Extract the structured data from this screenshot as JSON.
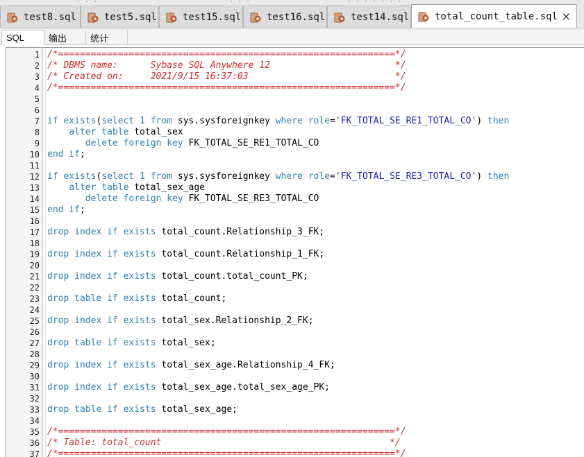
{
  "tabs": [
    {
      "label": "test8.sql",
      "active": false
    },
    {
      "label": "test5.sql",
      "active": false
    },
    {
      "label": "test15.sql",
      "active": false
    },
    {
      "label": "test16.sql",
      "active": false
    },
    {
      "label": "test14.sql",
      "active": false
    },
    {
      "label": "total_count_table.sql",
      "active": true
    }
  ],
  "close_icon": "×",
  "subtabs": [
    "SQL",
    "输出",
    "统计"
  ],
  "colors": {
    "keyword": "#2f7fb5",
    "string": "#1d1da8",
    "comment": "#d22b2b",
    "icon": "#c47a4f"
  },
  "code_lines": [
    {
      "n": "1",
      "t": [
        [
          "cm",
          "/*==============================================================*/"
        ]
      ]
    },
    {
      "n": "2",
      "t": [
        [
          "cm",
          "/* DBMS name:      Sybase SQL Anywhere 12                       */"
        ]
      ]
    },
    {
      "n": "3",
      "t": [
        [
          "cm",
          "/* Created on:     2021/9/15 16:37:03                           */"
        ]
      ]
    },
    {
      "n": "4",
      "t": [
        [
          "cm",
          "/*==============================================================*/"
        ]
      ]
    },
    {
      "n": "5",
      "t": []
    },
    {
      "n": "6",
      "t": []
    },
    {
      "n": "7",
      "t": [
        [
          "kw",
          "if exists"
        ],
        [
          "",
          "("
        ],
        [
          "kw",
          "select"
        ],
        [
          "",
          " "
        ],
        [
          "num",
          "1"
        ],
        [
          "",
          " "
        ],
        [
          "kw",
          "from"
        ],
        [
          "",
          " sys.sysforeignkey "
        ],
        [
          "kw",
          "where"
        ],
        [
          "",
          " "
        ],
        [
          "kw",
          "role"
        ],
        [
          "",
          "="
        ],
        [
          "str",
          "'FK_TOTAL_SE_RE1_TOTAL_CO'"
        ],
        [
          "",
          ") "
        ],
        [
          "kw",
          "then"
        ]
      ]
    },
    {
      "n": "8",
      "t": [
        [
          "",
          "    "
        ],
        [
          "kw",
          "alter table"
        ],
        [
          "",
          " total_sex"
        ]
      ]
    },
    {
      "n": "9",
      "t": [
        [
          "",
          "       "
        ],
        [
          "kw",
          "delete foreign key"
        ],
        [
          "",
          " FK_TOTAL_SE_RE1_TOTAL_CO"
        ]
      ]
    },
    {
      "n": "10",
      "t": [
        [
          "kw",
          "end if"
        ],
        [
          "",
          ";"
        ]
      ]
    },
    {
      "n": "11",
      "t": []
    },
    {
      "n": "12",
      "t": [
        [
          "kw",
          "if exists"
        ],
        [
          "",
          "("
        ],
        [
          "kw",
          "select"
        ],
        [
          "",
          " "
        ],
        [
          "num",
          "1"
        ],
        [
          "",
          " "
        ],
        [
          "kw",
          "from"
        ],
        [
          "",
          " sys.sysforeignkey "
        ],
        [
          "kw",
          "where"
        ],
        [
          "",
          " "
        ],
        [
          "kw",
          "role"
        ],
        [
          "",
          "="
        ],
        [
          "str",
          "'FK_TOTAL_SE_RE3_TOTAL_CO'"
        ],
        [
          "",
          ") "
        ],
        [
          "kw",
          "then"
        ]
      ]
    },
    {
      "n": "13",
      "t": [
        [
          "",
          "    "
        ],
        [
          "kw",
          "alter table"
        ],
        [
          "",
          " total_sex_age"
        ]
      ]
    },
    {
      "n": "14",
      "t": [
        [
          "",
          "       "
        ],
        [
          "kw",
          "delete foreign key"
        ],
        [
          "",
          " FK_TOTAL_SE_RE3_TOTAL_CO"
        ]
      ]
    },
    {
      "n": "15",
      "t": [
        [
          "kw",
          "end if"
        ],
        [
          "",
          ";"
        ]
      ]
    },
    {
      "n": "16",
      "t": []
    },
    {
      "n": "17",
      "t": [
        [
          "kw",
          "drop index if exists"
        ],
        [
          "",
          " total_count.Relationship_3_FK;"
        ]
      ]
    },
    {
      "n": "18",
      "t": []
    },
    {
      "n": "19",
      "t": [
        [
          "kw",
          "drop index if exists"
        ],
        [
          "",
          " total_count.Relationship_1_FK;"
        ]
      ]
    },
    {
      "n": "20",
      "t": []
    },
    {
      "n": "21",
      "t": [
        [
          "kw",
          "drop index if exists"
        ],
        [
          "",
          " total_count.total_count_PK;"
        ]
      ]
    },
    {
      "n": "22",
      "t": []
    },
    {
      "n": "23",
      "t": [
        [
          "kw",
          "drop table if exists"
        ],
        [
          "",
          " total_count;"
        ]
      ]
    },
    {
      "n": "24",
      "t": []
    },
    {
      "n": "25",
      "t": [
        [
          "kw",
          "drop index if exists"
        ],
        [
          "",
          " total_sex.Relationship_2_FK;"
        ]
      ]
    },
    {
      "n": "26",
      "t": []
    },
    {
      "n": "27",
      "t": [
        [
          "kw",
          "drop table if exists"
        ],
        [
          "",
          " total_sex;"
        ]
      ]
    },
    {
      "n": "28",
      "t": []
    },
    {
      "n": "29",
      "t": [
        [
          "kw",
          "drop index if exists"
        ],
        [
          "",
          " total_sex_age.Relationship_4_FK;"
        ]
      ]
    },
    {
      "n": "30",
      "t": []
    },
    {
      "n": "31",
      "t": [
        [
          "kw",
          "drop index if exists"
        ],
        [
          "",
          " total_sex_age.total_sex_age_PK;"
        ]
      ]
    },
    {
      "n": "32",
      "t": []
    },
    {
      "n": "33",
      "t": [
        [
          "kw",
          "drop table if exists"
        ],
        [
          "",
          " total_sex_age;"
        ]
      ]
    },
    {
      "n": "34",
      "t": []
    },
    {
      "n": "35",
      "t": [
        [
          "cm",
          "/*==============================================================*/"
        ]
      ]
    },
    {
      "n": "36",
      "t": [
        [
          "cm",
          "/* Table: total_count                                          */"
        ]
      ]
    },
    {
      "n": "37",
      "t": [
        [
          "cm",
          "/*==============================================================*/"
        ]
      ]
    }
  ]
}
